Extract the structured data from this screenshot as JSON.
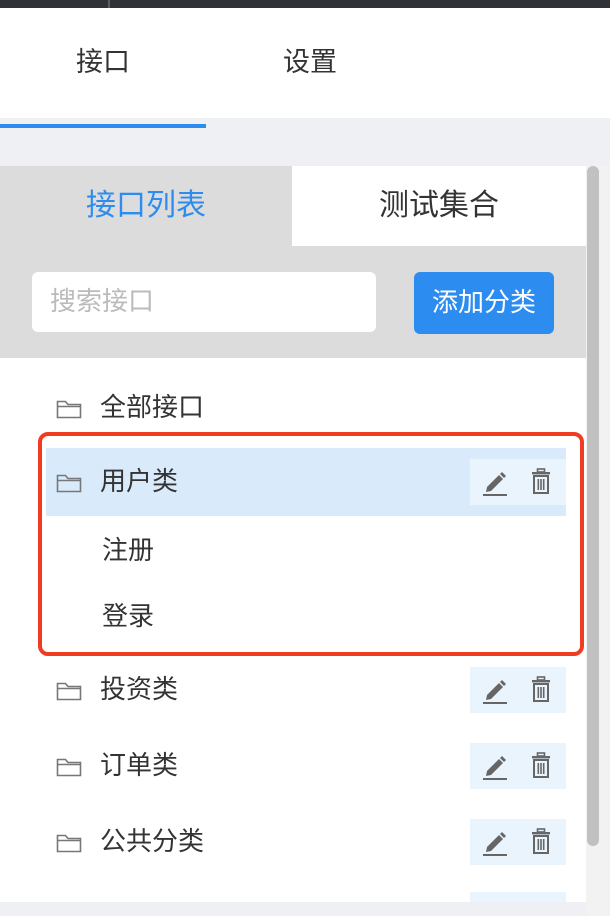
{
  "nav": {
    "tabs": [
      {
        "label": "接口",
        "active": true
      },
      {
        "label": "设置",
        "active": false
      }
    ]
  },
  "panel": {
    "tabs": [
      {
        "label": "接口列表",
        "active": true
      },
      {
        "label": "测试集合",
        "active": false
      }
    ],
    "search": {
      "value": "",
      "placeholder": "搜索接口"
    },
    "add_category_label": "添加分类"
  },
  "tree": {
    "all_label": "全部接口",
    "categories": [
      {
        "label": "用户类",
        "selected": true,
        "children": [
          "注册",
          "登录"
        ]
      },
      {
        "label": "投资类",
        "selected": false,
        "children": []
      },
      {
        "label": "订单类",
        "selected": false,
        "children": []
      },
      {
        "label": "公共分类",
        "selected": false,
        "children": []
      }
    ]
  },
  "colors": {
    "accent": "#2d8cf0",
    "highlight_border": "#f03c22",
    "selected_row": "#d9ebfb"
  },
  "icons": {
    "folder": "folder-icon",
    "edit": "edit-icon",
    "delete": "trash-icon"
  }
}
